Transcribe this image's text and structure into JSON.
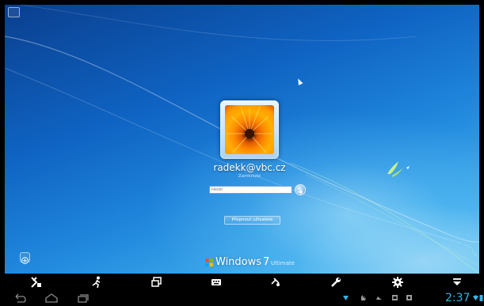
{
  "login": {
    "username": "radekk@vbc.cz",
    "status": "Zamknuto",
    "password_placeholder": "Heslo",
    "switch_user_label": "Přepnout uživatele"
  },
  "branding": {
    "name": "Windows",
    "version": "7",
    "edition": "Ultimate"
  },
  "android_toolbar": {
    "buttons": [
      "disconnect-icon",
      "run-icon",
      "window-switch-icon",
      "keyboard-icon",
      "touch-mode-icon",
      "tools-icon",
      "settings-icon",
      "menu-down-icon"
    ]
  },
  "android_nav": {
    "buttons": [
      "back-icon",
      "home-icon",
      "recent-apps-icon"
    ],
    "clock": "2:37",
    "status_icons": [
      "download-icon",
      "notification-icon",
      "cloud-icon",
      "sd-card-icon",
      "sync-icon",
      "wifi-icon",
      "battery-icon"
    ]
  },
  "colors": {
    "accent": "#33b5e5",
    "desktop": "#1f86dc"
  }
}
